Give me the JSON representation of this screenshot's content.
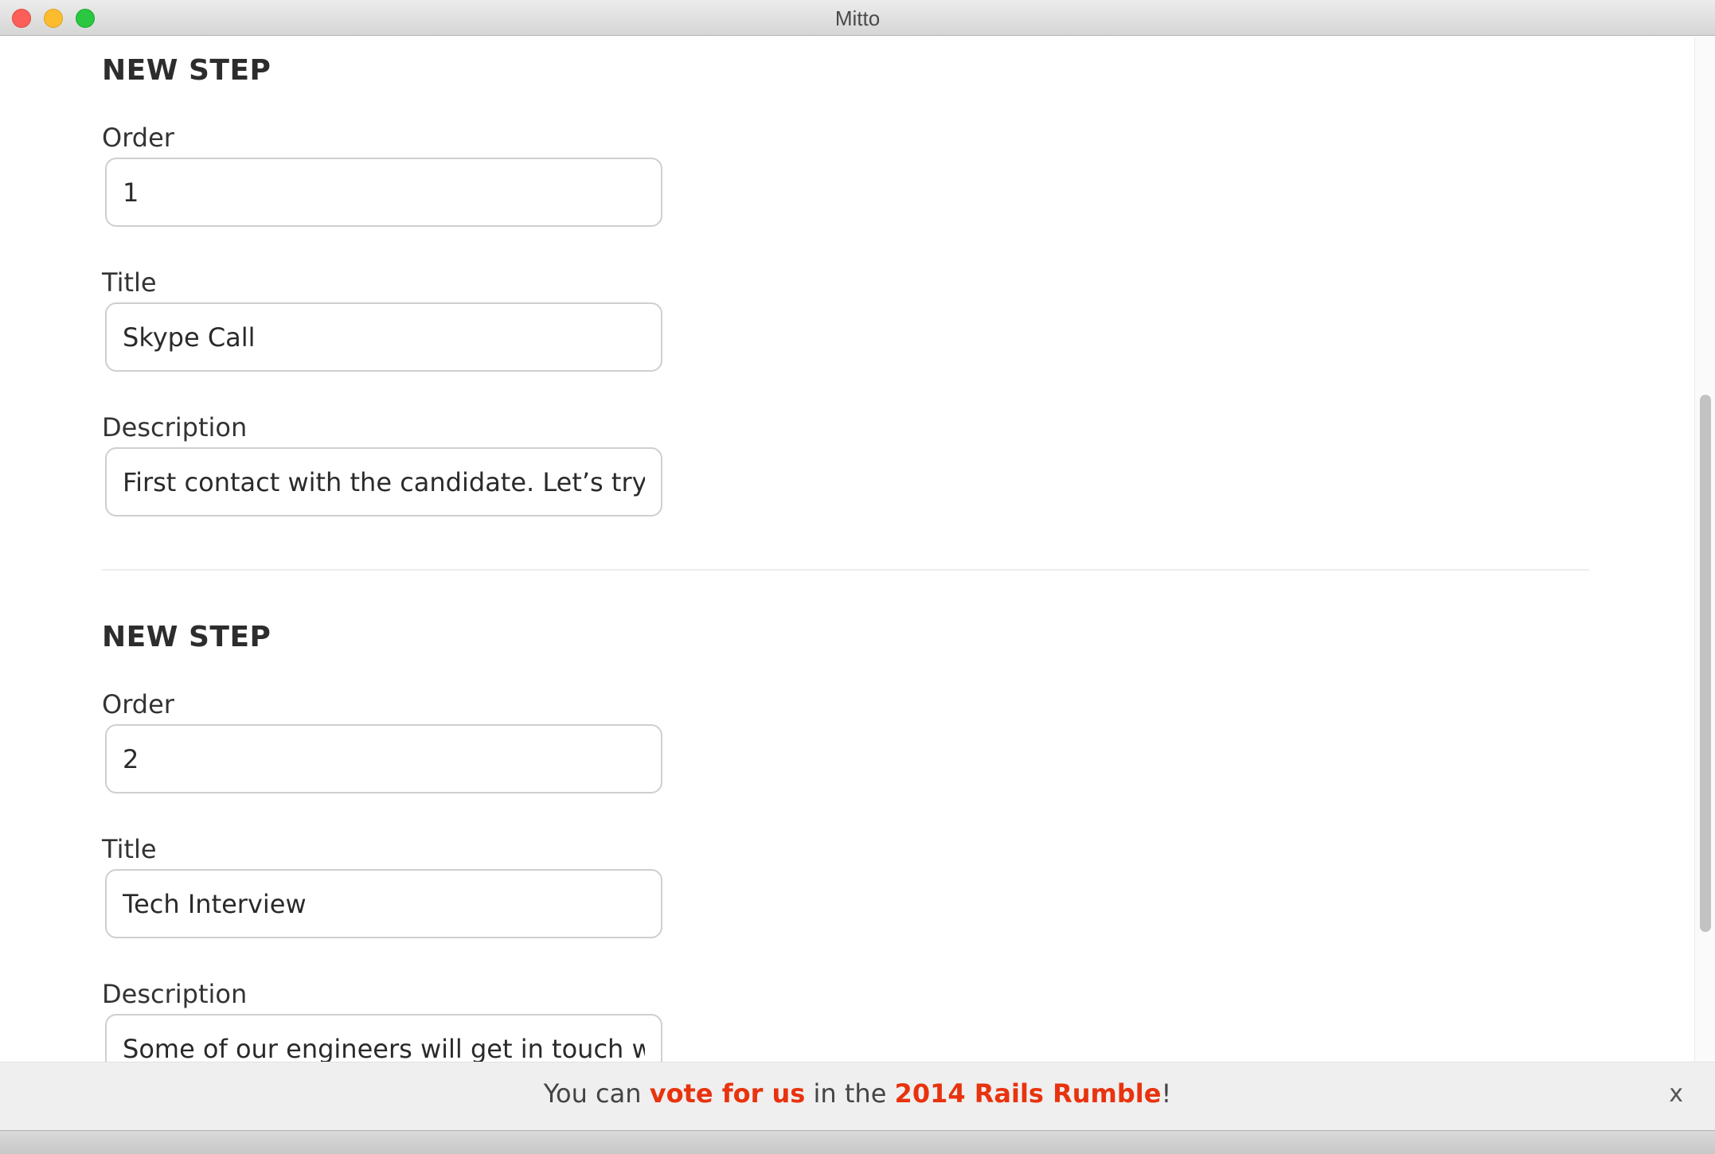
{
  "window": {
    "title": "Mitto"
  },
  "steps": [
    {
      "heading": "NEW STEP",
      "order_label": "Order",
      "order_value": "1",
      "title_label": "Title",
      "title_value": "Skype Call",
      "description_label": "Description",
      "description_value": "First contact with the candidate. Let’s try to k"
    },
    {
      "heading": "NEW STEP",
      "order_label": "Order",
      "order_value": "2",
      "title_label": "Title",
      "title_value": "Tech Interview",
      "description_label": "Description",
      "description_value": "Some of our engineers will get in touch with"
    }
  ],
  "banner": {
    "prefix": "You can ",
    "vote_link": "vote for us",
    "middle": " in the ",
    "rumble_link": "2014 Rails Rumble",
    "suffix": "!",
    "close_label": "x"
  },
  "colors": {
    "accent": "#e8330e",
    "close": "#fc5f57",
    "minimize": "#fdbc2e",
    "zoom": "#29c840"
  }
}
